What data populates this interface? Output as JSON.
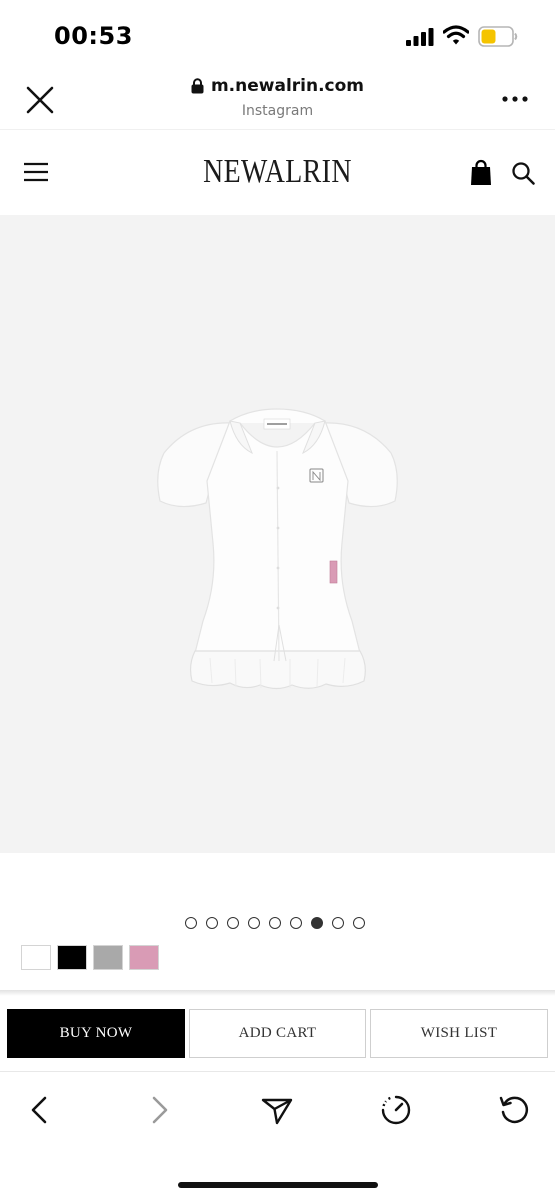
{
  "status_bar": {
    "time": "00:53",
    "icons": [
      "signal-icon",
      "wifi-icon",
      "battery-icon"
    ],
    "battery_color": "#f5c400"
  },
  "browser": {
    "url": "m.newalrin.com",
    "subtitle": "Instagram",
    "icons": [
      "close-icon",
      "lock-icon",
      "more-icon"
    ]
  },
  "site": {
    "brand": "NEWALRIN",
    "icons": [
      "hamburger-menu-icon",
      "shopping-bag-icon",
      "search-icon"
    ]
  },
  "product": {
    "image_alt": "white short-sleeve ruffle blouse",
    "image_bg": "#f3f3f3",
    "carousel": {
      "total": 9,
      "active_index": 6
    },
    "swatches": [
      {
        "name": "white",
        "color": "#ffffff"
      },
      {
        "name": "black",
        "color": "#000000"
      },
      {
        "name": "gray",
        "color": "#a9a9a9"
      },
      {
        "name": "pink",
        "color": "#d99bb5"
      }
    ]
  },
  "actions": {
    "buy_now": "BUY NOW",
    "add_cart": "ADD CART",
    "wish_list": "WISH LIST"
  },
  "toolbar": {
    "icons": [
      "back-arrow-icon",
      "forward-arrow-icon",
      "share-send-icon",
      "speed-dial-icon",
      "reload-icon"
    ]
  }
}
